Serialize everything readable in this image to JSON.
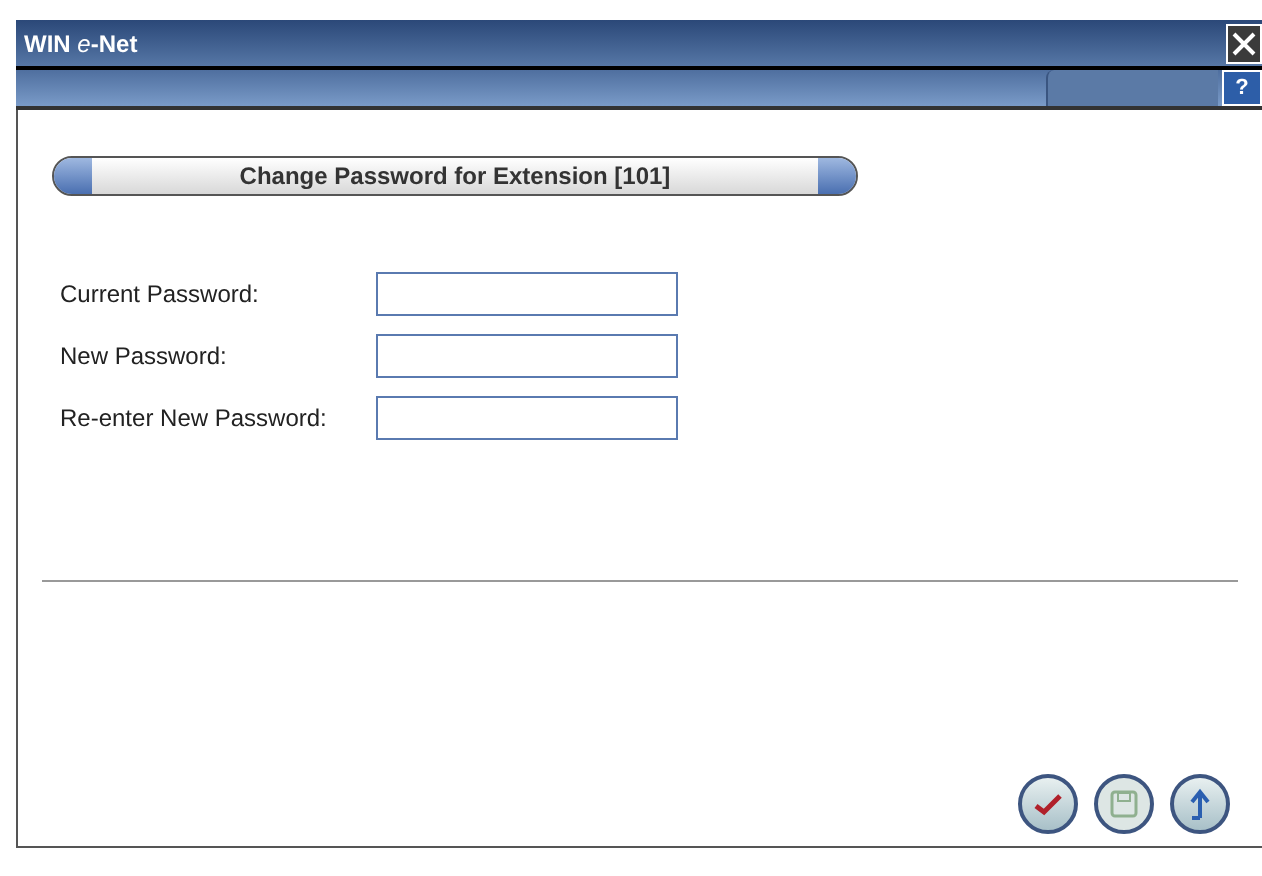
{
  "window": {
    "title_prefix": "WIN",
    "title_italic": "e",
    "title_suffix": "-Net"
  },
  "toolbar": {
    "help": "?"
  },
  "header": "Change Password for Extension [101]",
  "fields": [
    {
      "label": "Current Password:"
    },
    {
      "label": "New Password:"
    },
    {
      "label": "Re-enter New Password:"
    }
  ],
  "buttons": [
    {
      "kind": "confirm",
      "disabled": false
    },
    {
      "kind": "save",
      "disabled": true
    },
    {
      "kind": "upload",
      "disabled": false
    }
  ]
}
